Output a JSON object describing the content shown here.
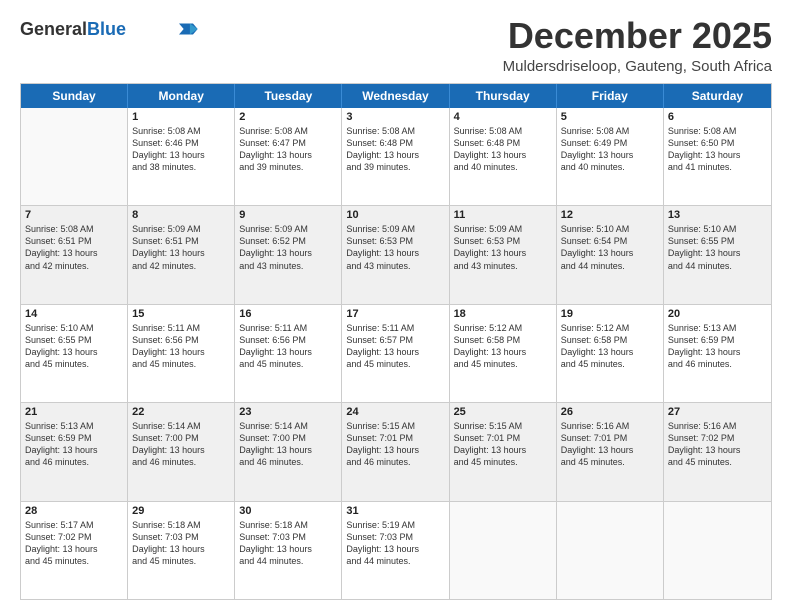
{
  "header": {
    "logo_general": "General",
    "logo_blue": "Blue",
    "month_title": "December 2025",
    "subtitle": "Muldersdriseloop, Gauteng, South Africa"
  },
  "days_of_week": [
    "Sunday",
    "Monday",
    "Tuesday",
    "Wednesday",
    "Thursday",
    "Friday",
    "Saturday"
  ],
  "weeks": [
    [
      {
        "day": "",
        "lines": []
      },
      {
        "day": "1",
        "lines": [
          "Sunrise: 5:08 AM",
          "Sunset: 6:46 PM",
          "Daylight: 13 hours",
          "and 38 minutes."
        ]
      },
      {
        "day": "2",
        "lines": [
          "Sunrise: 5:08 AM",
          "Sunset: 6:47 PM",
          "Daylight: 13 hours",
          "and 39 minutes."
        ]
      },
      {
        "day": "3",
        "lines": [
          "Sunrise: 5:08 AM",
          "Sunset: 6:48 PM",
          "Daylight: 13 hours",
          "and 39 minutes."
        ]
      },
      {
        "day": "4",
        "lines": [
          "Sunrise: 5:08 AM",
          "Sunset: 6:48 PM",
          "Daylight: 13 hours",
          "and 40 minutes."
        ]
      },
      {
        "day": "5",
        "lines": [
          "Sunrise: 5:08 AM",
          "Sunset: 6:49 PM",
          "Daylight: 13 hours",
          "and 40 minutes."
        ]
      },
      {
        "day": "6",
        "lines": [
          "Sunrise: 5:08 AM",
          "Sunset: 6:50 PM",
          "Daylight: 13 hours",
          "and 41 minutes."
        ]
      }
    ],
    [
      {
        "day": "7",
        "lines": [
          "Sunrise: 5:08 AM",
          "Sunset: 6:51 PM",
          "Daylight: 13 hours",
          "and 42 minutes."
        ]
      },
      {
        "day": "8",
        "lines": [
          "Sunrise: 5:09 AM",
          "Sunset: 6:51 PM",
          "Daylight: 13 hours",
          "and 42 minutes."
        ]
      },
      {
        "day": "9",
        "lines": [
          "Sunrise: 5:09 AM",
          "Sunset: 6:52 PM",
          "Daylight: 13 hours",
          "and 43 minutes."
        ]
      },
      {
        "day": "10",
        "lines": [
          "Sunrise: 5:09 AM",
          "Sunset: 6:53 PM",
          "Daylight: 13 hours",
          "and 43 minutes."
        ]
      },
      {
        "day": "11",
        "lines": [
          "Sunrise: 5:09 AM",
          "Sunset: 6:53 PM",
          "Daylight: 13 hours",
          "and 43 minutes."
        ]
      },
      {
        "day": "12",
        "lines": [
          "Sunrise: 5:10 AM",
          "Sunset: 6:54 PM",
          "Daylight: 13 hours",
          "and 44 minutes."
        ]
      },
      {
        "day": "13",
        "lines": [
          "Sunrise: 5:10 AM",
          "Sunset: 6:55 PM",
          "Daylight: 13 hours",
          "and 44 minutes."
        ]
      }
    ],
    [
      {
        "day": "14",
        "lines": [
          "Sunrise: 5:10 AM",
          "Sunset: 6:55 PM",
          "Daylight: 13 hours",
          "and 45 minutes."
        ]
      },
      {
        "day": "15",
        "lines": [
          "Sunrise: 5:11 AM",
          "Sunset: 6:56 PM",
          "Daylight: 13 hours",
          "and 45 minutes."
        ]
      },
      {
        "day": "16",
        "lines": [
          "Sunrise: 5:11 AM",
          "Sunset: 6:56 PM",
          "Daylight: 13 hours",
          "and 45 minutes."
        ]
      },
      {
        "day": "17",
        "lines": [
          "Sunrise: 5:11 AM",
          "Sunset: 6:57 PM",
          "Daylight: 13 hours",
          "and 45 minutes."
        ]
      },
      {
        "day": "18",
        "lines": [
          "Sunrise: 5:12 AM",
          "Sunset: 6:58 PM",
          "Daylight: 13 hours",
          "and 45 minutes."
        ]
      },
      {
        "day": "19",
        "lines": [
          "Sunrise: 5:12 AM",
          "Sunset: 6:58 PM",
          "Daylight: 13 hours",
          "and 45 minutes."
        ]
      },
      {
        "day": "20",
        "lines": [
          "Sunrise: 5:13 AM",
          "Sunset: 6:59 PM",
          "Daylight: 13 hours",
          "and 46 minutes."
        ]
      }
    ],
    [
      {
        "day": "21",
        "lines": [
          "Sunrise: 5:13 AM",
          "Sunset: 6:59 PM",
          "Daylight: 13 hours",
          "and 46 minutes."
        ]
      },
      {
        "day": "22",
        "lines": [
          "Sunrise: 5:14 AM",
          "Sunset: 7:00 PM",
          "Daylight: 13 hours",
          "and 46 minutes."
        ]
      },
      {
        "day": "23",
        "lines": [
          "Sunrise: 5:14 AM",
          "Sunset: 7:00 PM",
          "Daylight: 13 hours",
          "and 46 minutes."
        ]
      },
      {
        "day": "24",
        "lines": [
          "Sunrise: 5:15 AM",
          "Sunset: 7:01 PM",
          "Daylight: 13 hours",
          "and 46 minutes."
        ]
      },
      {
        "day": "25",
        "lines": [
          "Sunrise: 5:15 AM",
          "Sunset: 7:01 PM",
          "Daylight: 13 hours",
          "and 45 minutes."
        ]
      },
      {
        "day": "26",
        "lines": [
          "Sunrise: 5:16 AM",
          "Sunset: 7:01 PM",
          "Daylight: 13 hours",
          "and 45 minutes."
        ]
      },
      {
        "day": "27",
        "lines": [
          "Sunrise: 5:16 AM",
          "Sunset: 7:02 PM",
          "Daylight: 13 hours",
          "and 45 minutes."
        ]
      }
    ],
    [
      {
        "day": "28",
        "lines": [
          "Sunrise: 5:17 AM",
          "Sunset: 7:02 PM",
          "Daylight: 13 hours",
          "and 45 minutes."
        ]
      },
      {
        "day": "29",
        "lines": [
          "Sunrise: 5:18 AM",
          "Sunset: 7:03 PM",
          "Daylight: 13 hours",
          "and 45 minutes."
        ]
      },
      {
        "day": "30",
        "lines": [
          "Sunrise: 5:18 AM",
          "Sunset: 7:03 PM",
          "Daylight: 13 hours",
          "and 44 minutes."
        ]
      },
      {
        "day": "31",
        "lines": [
          "Sunrise: 5:19 AM",
          "Sunset: 7:03 PM",
          "Daylight: 13 hours",
          "and 44 minutes."
        ]
      },
      {
        "day": "",
        "lines": []
      },
      {
        "day": "",
        "lines": []
      },
      {
        "day": "",
        "lines": []
      }
    ]
  ]
}
